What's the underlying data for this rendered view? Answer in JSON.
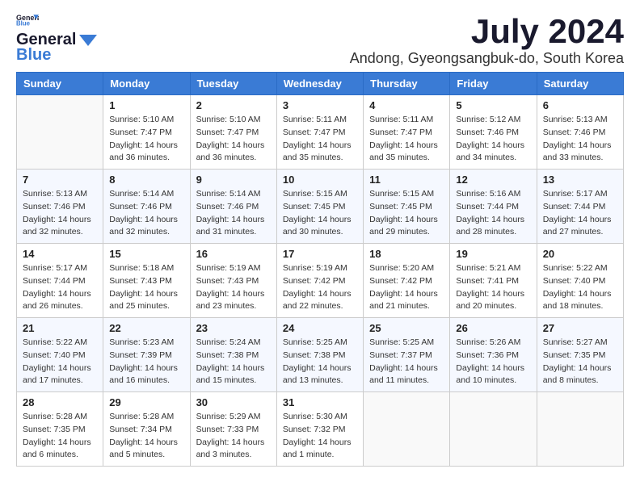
{
  "header": {
    "logo_general": "General",
    "logo_blue": "Blue",
    "month_year": "July 2024",
    "location": "Andong, Gyeongsangbuk-do, South Korea"
  },
  "days_of_week": [
    "Sunday",
    "Monday",
    "Tuesday",
    "Wednesday",
    "Thursday",
    "Friday",
    "Saturday"
  ],
  "weeks": [
    [
      {
        "day": "",
        "info": ""
      },
      {
        "day": "1",
        "info": "Sunrise: 5:10 AM\nSunset: 7:47 PM\nDaylight: 14 hours\nand 36 minutes."
      },
      {
        "day": "2",
        "info": "Sunrise: 5:10 AM\nSunset: 7:47 PM\nDaylight: 14 hours\nand 36 minutes."
      },
      {
        "day": "3",
        "info": "Sunrise: 5:11 AM\nSunset: 7:47 PM\nDaylight: 14 hours\nand 35 minutes."
      },
      {
        "day": "4",
        "info": "Sunrise: 5:11 AM\nSunset: 7:47 PM\nDaylight: 14 hours\nand 35 minutes."
      },
      {
        "day": "5",
        "info": "Sunrise: 5:12 AM\nSunset: 7:46 PM\nDaylight: 14 hours\nand 34 minutes."
      },
      {
        "day": "6",
        "info": "Sunrise: 5:13 AM\nSunset: 7:46 PM\nDaylight: 14 hours\nand 33 minutes."
      }
    ],
    [
      {
        "day": "7",
        "info": "Sunrise: 5:13 AM\nSunset: 7:46 PM\nDaylight: 14 hours\nand 32 minutes."
      },
      {
        "day": "8",
        "info": "Sunrise: 5:14 AM\nSunset: 7:46 PM\nDaylight: 14 hours\nand 32 minutes."
      },
      {
        "day": "9",
        "info": "Sunrise: 5:14 AM\nSunset: 7:46 PM\nDaylight: 14 hours\nand 31 minutes."
      },
      {
        "day": "10",
        "info": "Sunrise: 5:15 AM\nSunset: 7:45 PM\nDaylight: 14 hours\nand 30 minutes."
      },
      {
        "day": "11",
        "info": "Sunrise: 5:15 AM\nSunset: 7:45 PM\nDaylight: 14 hours\nand 29 minutes."
      },
      {
        "day": "12",
        "info": "Sunrise: 5:16 AM\nSunset: 7:44 PM\nDaylight: 14 hours\nand 28 minutes."
      },
      {
        "day": "13",
        "info": "Sunrise: 5:17 AM\nSunset: 7:44 PM\nDaylight: 14 hours\nand 27 minutes."
      }
    ],
    [
      {
        "day": "14",
        "info": "Sunrise: 5:17 AM\nSunset: 7:44 PM\nDaylight: 14 hours\nand 26 minutes."
      },
      {
        "day": "15",
        "info": "Sunrise: 5:18 AM\nSunset: 7:43 PM\nDaylight: 14 hours\nand 25 minutes."
      },
      {
        "day": "16",
        "info": "Sunrise: 5:19 AM\nSunset: 7:43 PM\nDaylight: 14 hours\nand 23 minutes."
      },
      {
        "day": "17",
        "info": "Sunrise: 5:19 AM\nSunset: 7:42 PM\nDaylight: 14 hours\nand 22 minutes."
      },
      {
        "day": "18",
        "info": "Sunrise: 5:20 AM\nSunset: 7:42 PM\nDaylight: 14 hours\nand 21 minutes."
      },
      {
        "day": "19",
        "info": "Sunrise: 5:21 AM\nSunset: 7:41 PM\nDaylight: 14 hours\nand 20 minutes."
      },
      {
        "day": "20",
        "info": "Sunrise: 5:22 AM\nSunset: 7:40 PM\nDaylight: 14 hours\nand 18 minutes."
      }
    ],
    [
      {
        "day": "21",
        "info": "Sunrise: 5:22 AM\nSunset: 7:40 PM\nDaylight: 14 hours\nand 17 minutes."
      },
      {
        "day": "22",
        "info": "Sunrise: 5:23 AM\nSunset: 7:39 PM\nDaylight: 14 hours\nand 16 minutes."
      },
      {
        "day": "23",
        "info": "Sunrise: 5:24 AM\nSunset: 7:38 PM\nDaylight: 14 hours\nand 15 minutes."
      },
      {
        "day": "24",
        "info": "Sunrise: 5:25 AM\nSunset: 7:38 PM\nDaylight: 14 hours\nand 13 minutes."
      },
      {
        "day": "25",
        "info": "Sunrise: 5:25 AM\nSunset: 7:37 PM\nDaylight: 14 hours\nand 11 minutes."
      },
      {
        "day": "26",
        "info": "Sunrise: 5:26 AM\nSunset: 7:36 PM\nDaylight: 14 hours\nand 10 minutes."
      },
      {
        "day": "27",
        "info": "Sunrise: 5:27 AM\nSunset: 7:35 PM\nDaylight: 14 hours\nand 8 minutes."
      }
    ],
    [
      {
        "day": "28",
        "info": "Sunrise: 5:28 AM\nSunset: 7:35 PM\nDaylight: 14 hours\nand 6 minutes."
      },
      {
        "day": "29",
        "info": "Sunrise: 5:28 AM\nSunset: 7:34 PM\nDaylight: 14 hours\nand 5 minutes."
      },
      {
        "day": "30",
        "info": "Sunrise: 5:29 AM\nSunset: 7:33 PM\nDaylight: 14 hours\nand 3 minutes."
      },
      {
        "day": "31",
        "info": "Sunrise: 5:30 AM\nSunset: 7:32 PM\nDaylight: 14 hours\nand 1 minute."
      },
      {
        "day": "",
        "info": ""
      },
      {
        "day": "",
        "info": ""
      },
      {
        "day": "",
        "info": ""
      }
    ]
  ]
}
